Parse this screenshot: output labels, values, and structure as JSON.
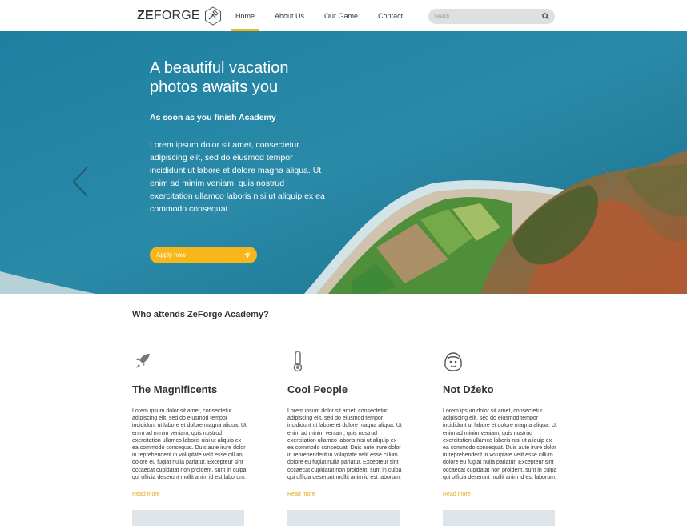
{
  "header": {
    "logo": {
      "bold": "ZE",
      "light": "FORGE"
    },
    "nav": [
      {
        "label": "Home",
        "active": true
      },
      {
        "label": "About Us",
        "active": false
      },
      {
        "label": "Our Game",
        "active": false
      },
      {
        "label": "Contact",
        "active": false
      }
    ],
    "search": {
      "placeholder": "Search",
      "value": ""
    }
  },
  "hero": {
    "title": "A beautiful vacation photos awaits you",
    "subtitle": "As soon as you finish Academy",
    "text": "Lorem ipsum dolor sit amet, consectetur adipiscing elit, sed do eiusmod tempor incididunt ut labore et dolore magna aliqua. Ut enim ad minim veniam, quis nostrud exercitation ullamco laboris nisi ut aliquip ex ea commodo consequat.",
    "cta_label": "Apply now"
  },
  "section": {
    "title": "Who attends ZeForge Academy?"
  },
  "columns": [
    {
      "icon": "rocket-icon",
      "title": "The Magnificents",
      "text": "Lorem ipsum dolor sit amet, consectetur adipiscing elit, sed do eiusmod tempor incididunt ut labore et dolore magna aliqua. Ut enim ad minim veniam, quis nostrud exercitation ullamco laboris nisi ut aliquip ex ea commodo consequat. Duis aute irure dolor in reprehenderit in voluptate velit esse cillum dolore eu fugiat nulla pariatur. Excepteur sint occaecat cupidatat non proident, sunt in culpa qui officia deserunt mollit anim id est laborum.",
      "link": "Read more"
    },
    {
      "icon": "thermometer-icon",
      "title": "Cool People",
      "text": "Lorem ipsum dolor sit amet, consectetur adipiscing elit, sed do eiusmod tempor incididunt ut labore et dolore magna aliqua. Ut enim ad minim veniam, quis nostrud exercitation ullamco laboris nisi ut aliquip ex ea commodo consequat. Duis aute irure dolor in reprehenderit in voluptate velit esse cillum dolore eu fugiat nulla pariatur. Excepteur sint occaecat cupidatat non proident, sunt in culpa qui officia deserunt mollit anim id est laborum.",
      "link": "Read more"
    },
    {
      "icon": "person-avatar-icon",
      "title": "Not Džeko",
      "text": "Lorem ipsum dolor sit amet, consectetur adipiscing elit, sed do eiusmod tempor incididunt ut labore et dolore magna aliqua. Ut enim ad minim veniam, quis nostrud exercitation ullamco laboris nisi ut aliquip ex ea commodo consequat. Duis aute irure dolor in reprehenderit in voluptate velit esse cillum dolore eu fugiat nulla pariatur. Excepteur sint occaecat cupidatat non proident, sunt in culpa qui officia deserunt mollit anim id est laborum.",
      "link": "Read more"
    }
  ],
  "colors": {
    "accent": "#f7b71a",
    "link": "#e3a61a",
    "text": "#333333",
    "sea": "#1f7c9c"
  }
}
